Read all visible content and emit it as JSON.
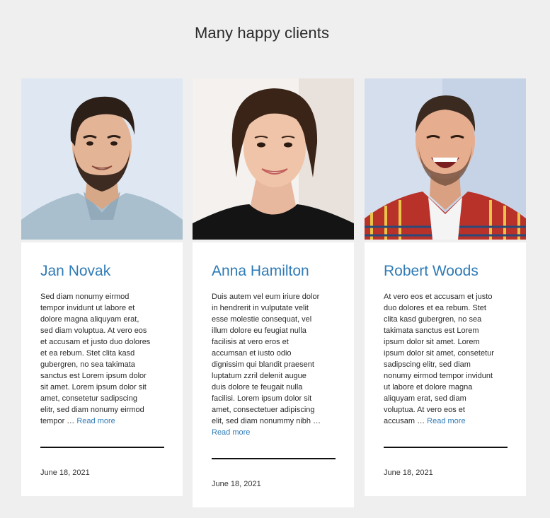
{
  "section": {
    "title": "Many happy clients"
  },
  "cards": [
    {
      "name": "Jan Novak",
      "excerpt": "Sed diam nonumy eirmod\ntempor invidunt ut labore et\ndolore magna aliquyam erat,\nsed diam voluptua. At vero eos\net accusam et justo duo dolores\net ea rebum. Stet clita kasd\ngubergren, no sea takimata\nsanctus est Lorem ipsum dolor\nsit amet. Lorem ipsum dolor sit\namet, consetetur sadipscing\nelitr, sed diam nonumy eirmod\ntempor …",
      "read_more": "Read more",
      "date": "June 18, 2021",
      "photo_alt": "portrait-man-beard"
    },
    {
      "name": "Anna Hamilton",
      "excerpt": "Duis autem vel eum iriure dolor\nin hendrerit in vulputate velit\nesse molestie consequat, vel\nillum dolore eu feugiat nulla\nfacilisis at vero eros et\naccumsan et iusto odio\ndignissim qui blandit praesent\nluptatum zzril delenit augue\nduis dolore te feugait nulla\nfacilisi. Lorem ipsum dolor sit\namet, consectetuer adipiscing\nelit, sed diam nonummy nibh …",
      "read_more": "Read more",
      "date": "June 18, 2021",
      "photo_alt": "portrait-woman-smiling"
    },
    {
      "name": "Robert Woods",
      "excerpt": "At vero eos et accusam et justo\nduo dolores et ea rebum. Stet\nclita kasd gubergren, no sea\ntakimata sanctus est Lorem\nipsum dolor sit amet. Lorem\nipsum dolor sit amet, consetetur\nsadipscing elitr, sed diam\nnonumy eirmod tempor invidunt\nut labore et dolore magna\naliquyam erat, sed diam\nvoluptua. At vero eos et\naccusam …",
      "read_more": "Read more",
      "date": "June 18, 2021",
      "photo_alt": "portrait-man-plaid-shirt"
    }
  ],
  "colors": {
    "background": "#efefef",
    "card": "#ffffff",
    "accent": "#2f7bb6",
    "text": "#2a2a2a",
    "divider": "#111111"
  }
}
